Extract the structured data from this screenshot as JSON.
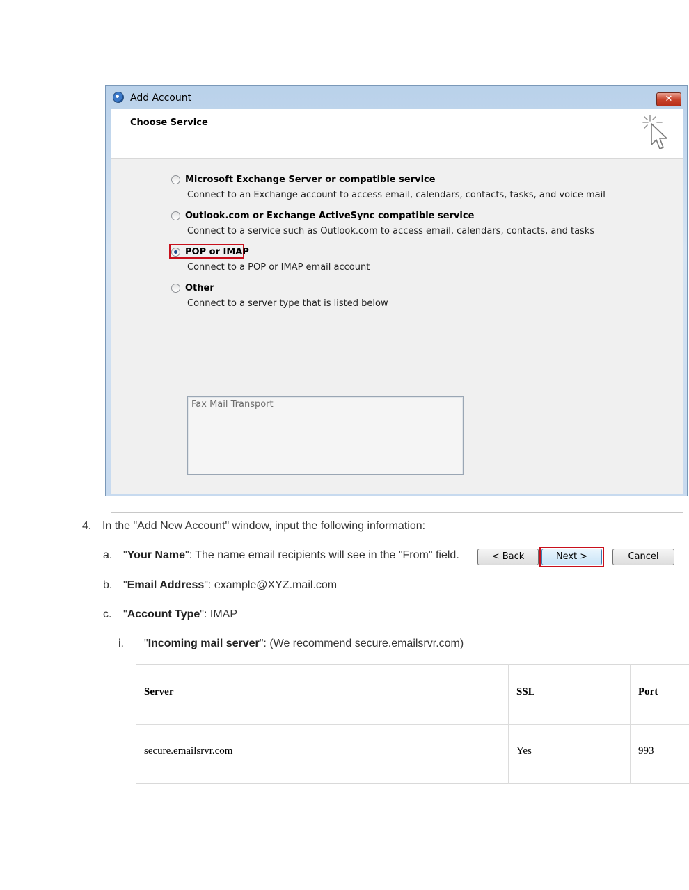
{
  "dialog": {
    "title": "Add Account",
    "close_label": "✕",
    "header_title": "Choose Service",
    "options": [
      {
        "label": "Microsoft Exchange Server or compatible service",
        "description": "Connect to an Exchange account to access email, calendars, contacts, tasks, and voice mail",
        "checked": false
      },
      {
        "label": "Outlook.com or Exchange ActiveSync compatible service",
        "description": "Connect to a service such as Outlook.com to access email, calendars, contacts, and tasks",
        "checked": false
      },
      {
        "label": "POP or IMAP",
        "description": "Connect to a POP or IMAP email account",
        "checked": true
      },
      {
        "label": "Other",
        "description": "Connect to a server type that is listed below",
        "checked": false
      }
    ],
    "listbox_items": [
      "Fax Mail Transport"
    ],
    "buttons": {
      "back": "< Back",
      "next": "Next >",
      "cancel": "Cancel"
    }
  },
  "instructions": {
    "step_number": "4.",
    "step_text": "In the \"Add New Account\" window, input the following information:",
    "items": [
      {
        "marker": "a.",
        "field": "Your Name",
        "rest": "\": The name email recipients will see in the \"From\" field."
      },
      {
        "marker": "b.",
        "field": "Email Address",
        "rest": "\": example@XYZ.mail.com"
      },
      {
        "marker": "c.",
        "field": "Account Type",
        "rest": "\": IMAP"
      }
    ],
    "subitem": {
      "marker": "i.",
      "field": "Incoming mail server",
      "rest": "\": (We recommend secure.emailsrvr.com)"
    },
    "quote_open": "\""
  },
  "table": {
    "headers": [
      "Server",
      "SSL",
      "Port"
    ],
    "rows": [
      [
        "secure.emailsrvr.com",
        "Yes",
        "993"
      ]
    ]
  }
}
